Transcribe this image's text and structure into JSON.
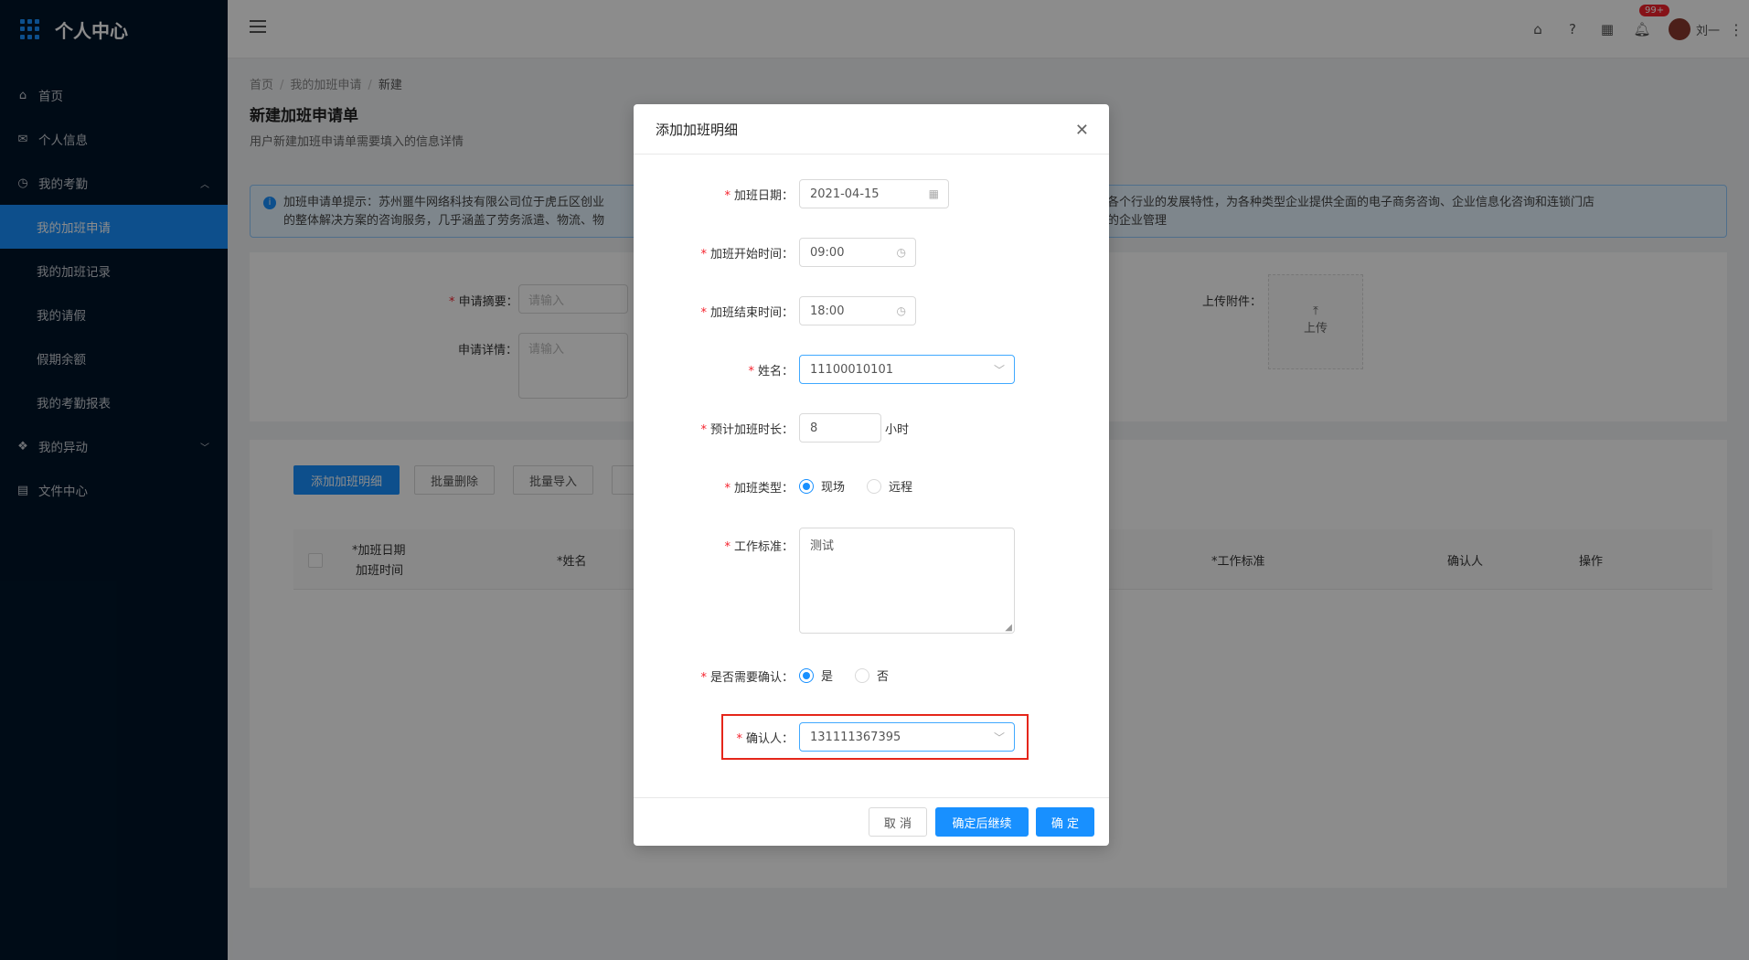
{
  "app": {
    "title": "个人中心"
  },
  "sidebar": {
    "items": [
      {
        "label": "首页",
        "icon": "home-icon"
      },
      {
        "label": "个人信息",
        "icon": "mail-icon"
      },
      {
        "label": "我的考勤",
        "icon": "clock-icon"
      },
      {
        "label": "我的加班申请"
      },
      {
        "label": "我的加班记录"
      },
      {
        "label": "我的请假"
      },
      {
        "label": "假期余额"
      },
      {
        "label": "我的考勤报表"
      },
      {
        "label": "我的异动",
        "icon": "gift-icon"
      },
      {
        "label": "文件中心",
        "icon": "file-icon"
      }
    ]
  },
  "header": {
    "badge": "99+",
    "user": "刘一"
  },
  "breadcrumb": {
    "home": "首页",
    "parent": "我的加班申请",
    "current": "新建"
  },
  "page": {
    "title": "新建加班申请单",
    "subtitle": "用户新建加班申请单需要填入的信息详情",
    "alert_line1_a": "加班申请单提示：苏州噩牛网络科技有限公司位于虎丘区创业",
    "alert_line1_b": "针对中国市场各个行业的发展特性，为各种类型企业提供全面的电子商务咨询、企业信息化咨询和连锁门店",
    "alert_line2_a": "的整体解决方案的咨询服务，几乎涵盖了劳务派遣、物流、物",
    "alert_line2_b": "化运营为一体的企业管理"
  },
  "form": {
    "summary_label": "申请摘要：",
    "summary_placeholder": "请输入",
    "detail_label": "申请详情：",
    "detail_placeholder": "请输入",
    "attach_label": "上传附件：",
    "upload_label": "上传"
  },
  "toolbar": {
    "add": "添加加班明细",
    "batch_delete": "批量删除",
    "batch_import": "批量导入",
    "export": "导"
  },
  "table": {
    "col_date": "*加班日期",
    "col_time": "加班时间",
    "col_name": "*姓名",
    "col_standard": "*工作标准",
    "col_confirmer": "确认人",
    "col_action": "操作"
  },
  "modal": {
    "title": "添加加班明细",
    "date_label": "加班日期：",
    "date_value": "2021-04-15",
    "start_label": "加班开始时间：",
    "start_value": "09:00",
    "end_label": "加班结束时间：",
    "end_value": "18:00",
    "name_label": "姓名：",
    "name_value": "11100010101",
    "hours_label": "预计加班时长：",
    "hours_value": "8",
    "hours_unit": "小时",
    "type_label": "加班类型：",
    "type_opt1": "现场",
    "type_opt2": "远程",
    "standard_label": "工作标准：",
    "standard_value": "测试",
    "confirm_label": "是否需要确认：",
    "confirm_yes": "是",
    "confirm_no": "否",
    "confirmer_label": "确认人：",
    "confirmer_value": "131111367395",
    "cancel": "取 消",
    "ok_continue": "确定后继续",
    "ok": "确 定"
  }
}
